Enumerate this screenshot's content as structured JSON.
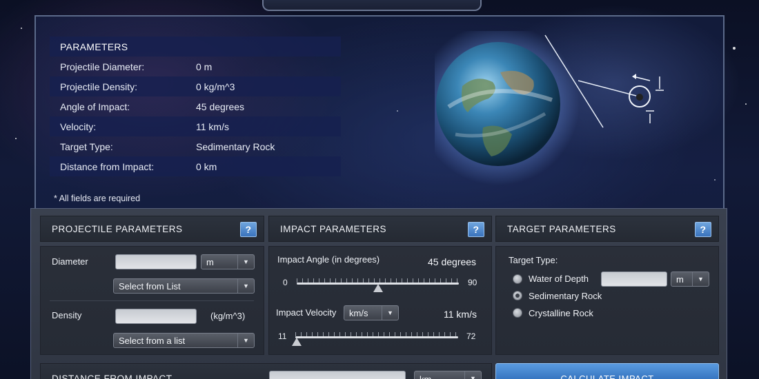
{
  "summary": {
    "title": "PARAMETERS",
    "rows": [
      {
        "label": "Projectile Diameter:",
        "value": "0 m"
      },
      {
        "label": "Projectile Density:",
        "value": "0 kg/m^3"
      },
      {
        "label": "Angle of Impact:",
        "value": "45 degrees"
      },
      {
        "label": "Velocity:",
        "value": "11 km/s"
      },
      {
        "label": "Target Type:",
        "value": "Sedimentary Rock"
      },
      {
        "label": "Distance from Impact:",
        "value": "0 km"
      }
    ],
    "required_note": "* All fields are required"
  },
  "projectile": {
    "title": "PROJECTILE PARAMETERS",
    "help": "?",
    "diameter_label": "Diameter",
    "diameter_unit": "m",
    "diameter_list": "Select from List",
    "density_label": "Density",
    "density_unit": "(kg/m^3)",
    "density_list": "Select from a list"
  },
  "impact": {
    "title": "IMPACT PARAMETERS",
    "help": "?",
    "angle_label": "Impact Angle (in degrees)",
    "angle_value": "45 degrees",
    "angle_min": "0",
    "angle_max": "90",
    "angle_fraction": 0.5,
    "velocity_label": "Impact Velocity",
    "velocity_unit": "km/s",
    "velocity_value": "11 km/s",
    "velocity_min": "11",
    "velocity_max": "72",
    "velocity_fraction": 0.0
  },
  "target": {
    "title": "TARGET PARAMETERS",
    "help": "?",
    "type_label": "Target Type:",
    "options": [
      "Water of Depth",
      "Sedimentary Rock",
      "Crystalline Rock"
    ],
    "selected": "Sedimentary Rock",
    "depth_unit": "m"
  },
  "distance": {
    "title": "DISTANCE FROM IMPACT",
    "unit": "km"
  },
  "calculate_label": "CALCULATE IMPACT",
  "colors": {
    "accent": "#3a73bd",
    "panel": "#2a2f39",
    "space": "#121a38"
  }
}
